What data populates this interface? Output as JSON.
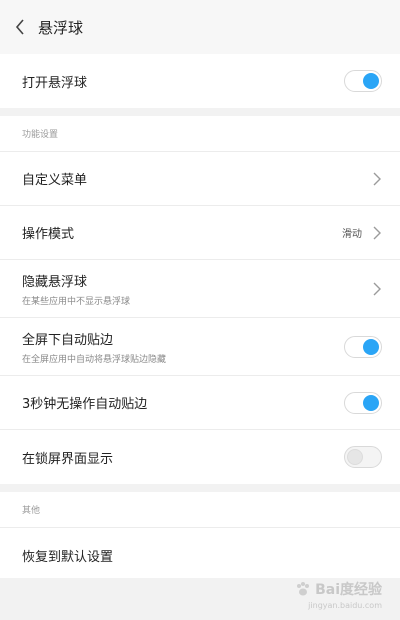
{
  "header": {
    "title": "悬浮球"
  },
  "main_toggle": {
    "label": "打开悬浮球",
    "enabled": true
  },
  "section_function": {
    "title": "功能设置",
    "items": [
      {
        "label": "自定义菜单"
      },
      {
        "label": "操作模式",
        "value": "滑动"
      },
      {
        "label": "隐藏悬浮球",
        "sub": "在某些应用中不显示悬浮球"
      },
      {
        "label": "全屏下自动贴边",
        "sub": "在全屏应用中自动将悬浮球贴边隐藏",
        "enabled": true
      },
      {
        "label": "3秒钟无操作自动贴边",
        "enabled": true
      },
      {
        "label": "在锁屏界面显示",
        "enabled": false
      }
    ]
  },
  "section_other": {
    "title": "其他",
    "items": [
      {
        "label": "恢复到默认设置"
      }
    ]
  },
  "watermark": {
    "main": "Bai度经验",
    "sub": "jingyan.baidu.com"
  },
  "colors": {
    "accent": "#2aa5f6",
    "background": "#f2f2f2"
  }
}
